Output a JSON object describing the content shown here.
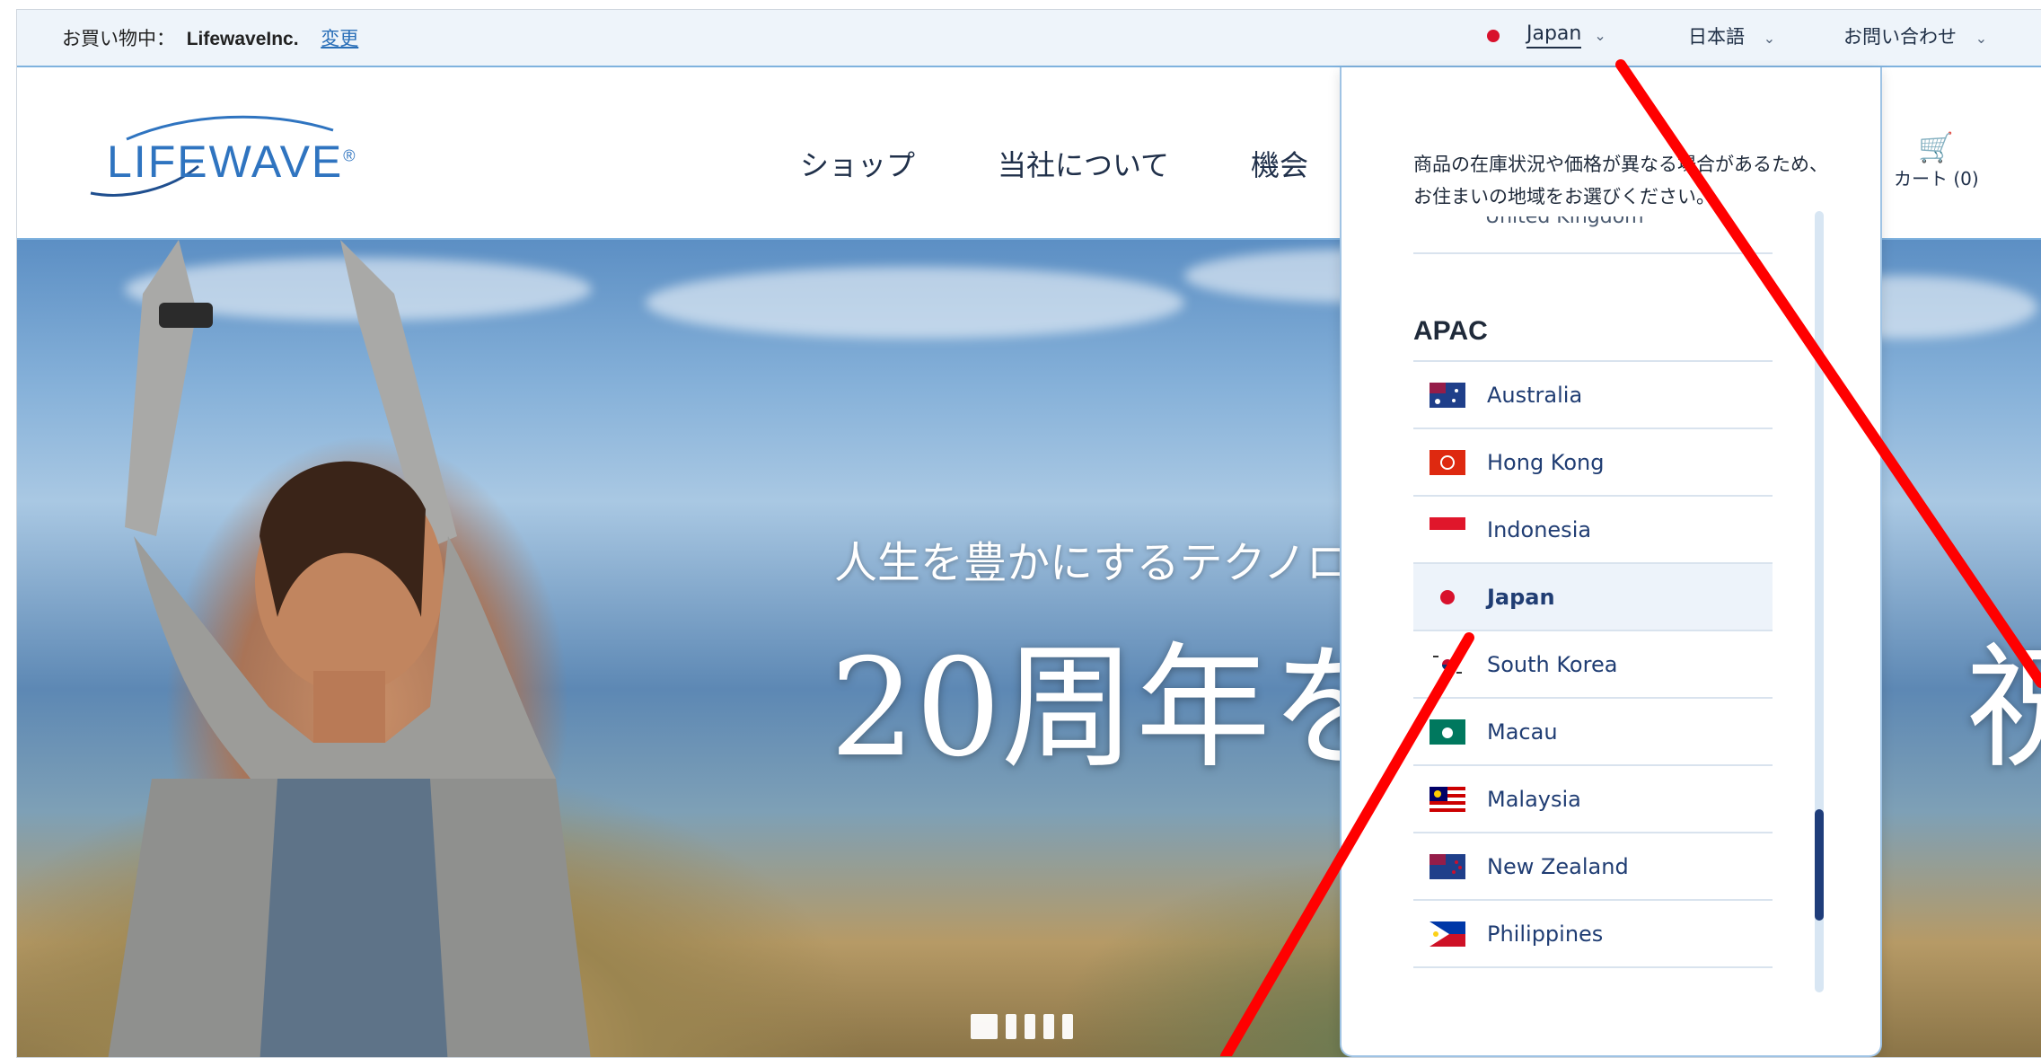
{
  "topbar": {
    "shopping_label": "お買い物中：",
    "shopping_store": "LifewaveInc.",
    "change_link": "変更",
    "country": "Japan",
    "language": "日本語",
    "contact": "お問い合わせ"
  },
  "header": {
    "logo_text": "LIFEWAVE",
    "logo_mark": "®",
    "nav": [
      "ショップ",
      "当社について",
      "機会"
    ],
    "cart_label": "カート (0)"
  },
  "hero": {
    "subtitle": "人生を豊かにするテクノロ",
    "title": "20周年を",
    "title_right": "祝う",
    "slides": 5,
    "active_slide": 1
  },
  "dropdown": {
    "note": "商品の在庫状況や価格が異なる場合があるため、お住まいの地域をお選びください。",
    "previous_item": "United Kingdom",
    "region": "APAC",
    "items": [
      {
        "label": "Australia",
        "flag": "australia-flag"
      },
      {
        "label": "Hong Kong",
        "flag": "hong-kong-flag"
      },
      {
        "label": "Indonesia",
        "flag": "indonesia-flag"
      },
      {
        "label": "Japan",
        "flag": "japan-flag",
        "selected": true
      },
      {
        "label": "South Korea",
        "flag": "south-korea-flag"
      },
      {
        "label": "Macau",
        "flag": "macau-flag"
      },
      {
        "label": "Malaysia",
        "flag": "malaysia-flag"
      },
      {
        "label": "New Zealand",
        "flag": "new-zealand-flag"
      },
      {
        "label": "Philippines",
        "flag": "philippines-flag"
      }
    ]
  },
  "colors": {
    "accent": "#2f74c0",
    "selected_bg": "#edf3fa",
    "annotation": "#ff0000"
  }
}
